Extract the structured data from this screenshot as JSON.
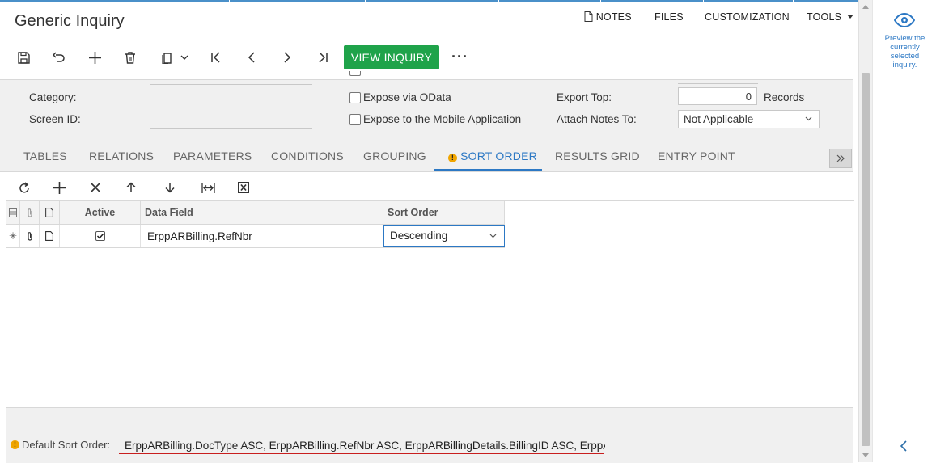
{
  "window": {
    "title": "Generic Inquiry"
  },
  "top_links": {
    "notes": "NOTES",
    "files": "FILES",
    "customization": "CUSTOMIZATION",
    "tools": "TOOLS"
  },
  "toolbar": {
    "view_inquiry": "VIEW INQUIRY",
    "more": "···"
  },
  "form": {
    "category_label": "Category:",
    "screen_id_label": "Screen ID:",
    "expose_odata_label": "Expose via OData",
    "expose_mobile_label": "Expose to the Mobile Application",
    "export_top_label": "Export Top:",
    "export_top_value": "0",
    "records_label": "Records",
    "attach_notes_label": "Attach Notes To:",
    "attach_notes_value": "Not Applicable"
  },
  "tabs": [
    "TABLES",
    "RELATIONS",
    "PARAMETERS",
    "CONDITIONS",
    "GROUPING",
    "SORT ORDER",
    "RESULTS GRID",
    "ENTRY POINT"
  ],
  "active_tab": "SORT ORDER",
  "grid": {
    "headers": {
      "active": "Active",
      "data_field": "Data Field",
      "sort_order": "Sort Order"
    },
    "rows": [
      {
        "active": true,
        "data_field": "ErppARBilling.RefNbr",
        "sort_order": "Descending"
      }
    ]
  },
  "bottom": {
    "default_sort_label": "Default Sort Order:",
    "default_sort_value": "ErppARBilling.DocType ASC, ErppARBilling.RefNbr ASC, ErppARBillingDetails.BillingID ASC, ErppAR"
  },
  "right_panel": {
    "preview_text": "Preview the currently selected inquiry."
  },
  "colors": {
    "accent": "#2c78c4",
    "view_button": "#1fa34a",
    "warning": "#f0a500",
    "error_underline": "#c81e1e"
  },
  "icons": [
    "save-icon",
    "undo-icon",
    "add-icon",
    "delete-icon",
    "copy-paste-icon",
    "first-record-icon",
    "previous-record-icon",
    "next-record-icon",
    "last-record-icon",
    "refresh-icon",
    "remove-icon",
    "move-up-icon",
    "move-down-icon",
    "fit-columns-icon",
    "export-excel-icon",
    "eye-icon",
    "collapse-left-icon"
  ]
}
